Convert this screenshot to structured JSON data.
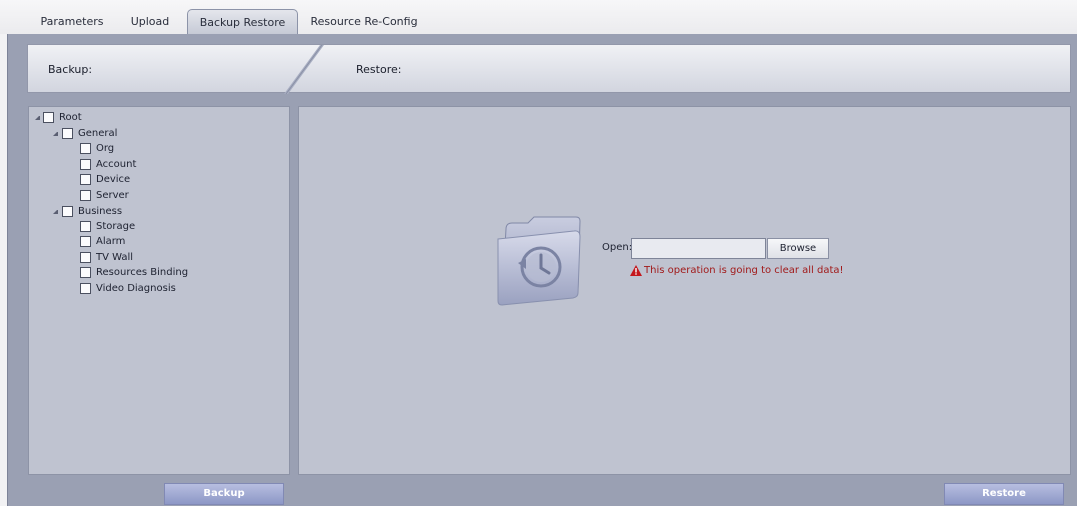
{
  "tabs": [
    {
      "label": "Parameters",
      "active": false
    },
    {
      "label": "Upload",
      "active": false
    },
    {
      "label": "Backup Restore",
      "active": true
    },
    {
      "label": "Resource Re-Config",
      "active": false
    }
  ],
  "header": {
    "backup_label": "Backup:",
    "restore_label": "Restore:"
  },
  "backup_tree": {
    "root": {
      "label": "Root",
      "checked": false,
      "expanded": true,
      "children": [
        {
          "label": "General",
          "checked": false,
          "expanded": true,
          "children": [
            {
              "label": "Org",
              "checked": false
            },
            {
              "label": "Account",
              "checked": false
            },
            {
              "label": "Device",
              "checked": false
            },
            {
              "label": "Server",
              "checked": false
            }
          ]
        },
        {
          "label": "Business",
          "checked": false,
          "expanded": true,
          "children": [
            {
              "label": "Storage",
              "checked": false
            },
            {
              "label": "Alarm",
              "checked": false
            },
            {
              "label": "TV Wall",
              "checked": false
            },
            {
              "label": "Resources Binding",
              "checked": false
            },
            {
              "label": "Video Diagnosis",
              "checked": false
            }
          ]
        }
      ]
    }
  },
  "restore": {
    "open_label": "Open:",
    "open_value": "",
    "browse_label": "Browse",
    "warning_text": "This operation is going to clear all data!",
    "warning_icon": "warning-triangle-icon",
    "folder_icon": "backup-history-folder-icon"
  },
  "buttons": {
    "backup_label": "Backup",
    "restore_label": "Restore"
  },
  "colors": {
    "panel_bg": "#bfc3d0",
    "frame_bg": "#9aa0b3",
    "button_bg": "#9aa3cf",
    "warning_text": "#a11a1a",
    "warning_icon": "#c4161c"
  }
}
